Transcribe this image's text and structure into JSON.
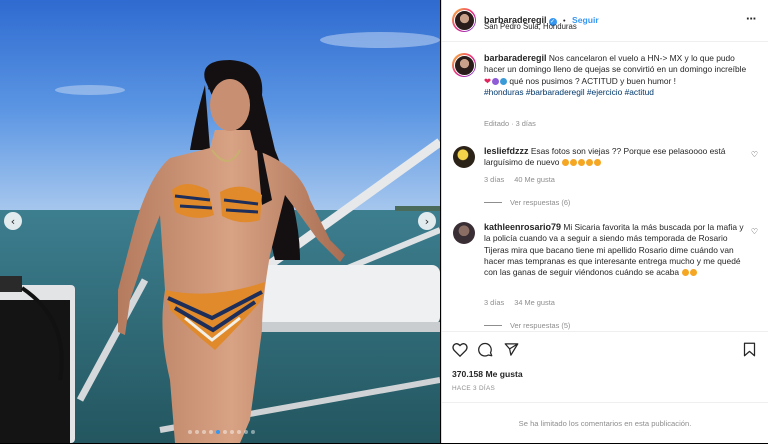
{
  "post": {
    "username": "barbaraderegil",
    "follow_label": "Seguir",
    "separator": "•",
    "location": "San Pedro Sula, Honduras",
    "more_icon": "more-horizontal-icon"
  },
  "caption": {
    "username": "barbaraderegil",
    "text_1": "Nos cancelaron el vuelo a HN-> MX y lo que pudo hacer un domingo lleno de quejas se convirtió en un domingo increíble",
    "text_2": "qué nos pusimos ? ACTITUD y buen humor !",
    "hashtags": "#honduras #barbaraderegil #ejercicio #actitud",
    "meta": "Editado · 3 días"
  },
  "comments": [
    {
      "username": "lesliefdzzz",
      "text": "Esas fotos son viejas ?? Porque ese pelasoooo está larguísimo de nuevo",
      "age": "3 días",
      "likes": "40 Me gusta",
      "view_replies": "Ver respuestas (6)"
    },
    {
      "username": "kathleenrosario79",
      "text": "Mi Sicaria favorita la más buscada por la mafia y la policía cuando va a seguir a siendo más temporada de Rosario Tijeras mira que bacano tiene mi apellido Rosario dime cuándo van hacer mas tempranas es que interesante entrega mucho y me quedé con las ganas de seguir viéndonos cuándo se acaba",
      "age": "3 días",
      "likes": "34 Me gusta",
      "view_replies": "Ver respuestas (5)"
    }
  ],
  "actions": {
    "likes": "370.158 Me gusta",
    "posted": "HACE 3 DÍAS"
  },
  "comment_bar": {
    "text": "Se ha limitado los comentarios en esta publicación."
  },
  "carousel": {
    "prev": "‹",
    "next": "›",
    "slides": 10,
    "active_index": 4
  },
  "colors": {
    "accent": "#3897f0",
    "link": "#00376b",
    "muted": "#8e8e8e",
    "text": "#262626"
  }
}
